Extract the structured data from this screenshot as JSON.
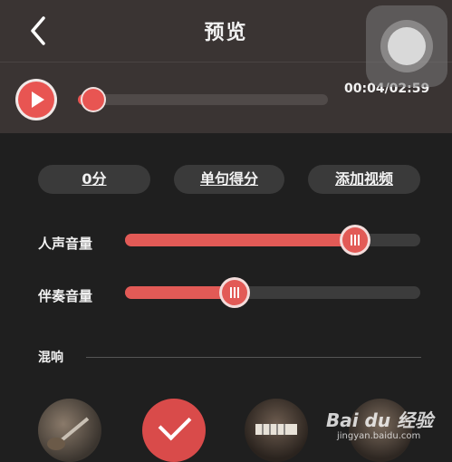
{
  "header": {
    "title": "预览"
  },
  "player": {
    "time": "00:04/02:59",
    "progress": 0.06
  },
  "actions": {
    "score": "0分",
    "sentence_score": "单句得分",
    "add_video": "添加视频"
  },
  "volume": {
    "vocal_label": "人声音量",
    "vocal_level": 0.78,
    "accomp_label": "伴奏音量",
    "accomp_level": 0.37
  },
  "reverb": {
    "label": "混响",
    "presets": [
      "guitar",
      "selected",
      "piano",
      "instrument"
    ],
    "selected_index": 1
  },
  "watermark": {
    "brand": "Bai du 经验",
    "sub": "jingyan.baidu.com"
  },
  "colors": {
    "accent": "#e85552",
    "bar_bg": "#3a3433",
    "page_bg": "#1f1f1f"
  }
}
